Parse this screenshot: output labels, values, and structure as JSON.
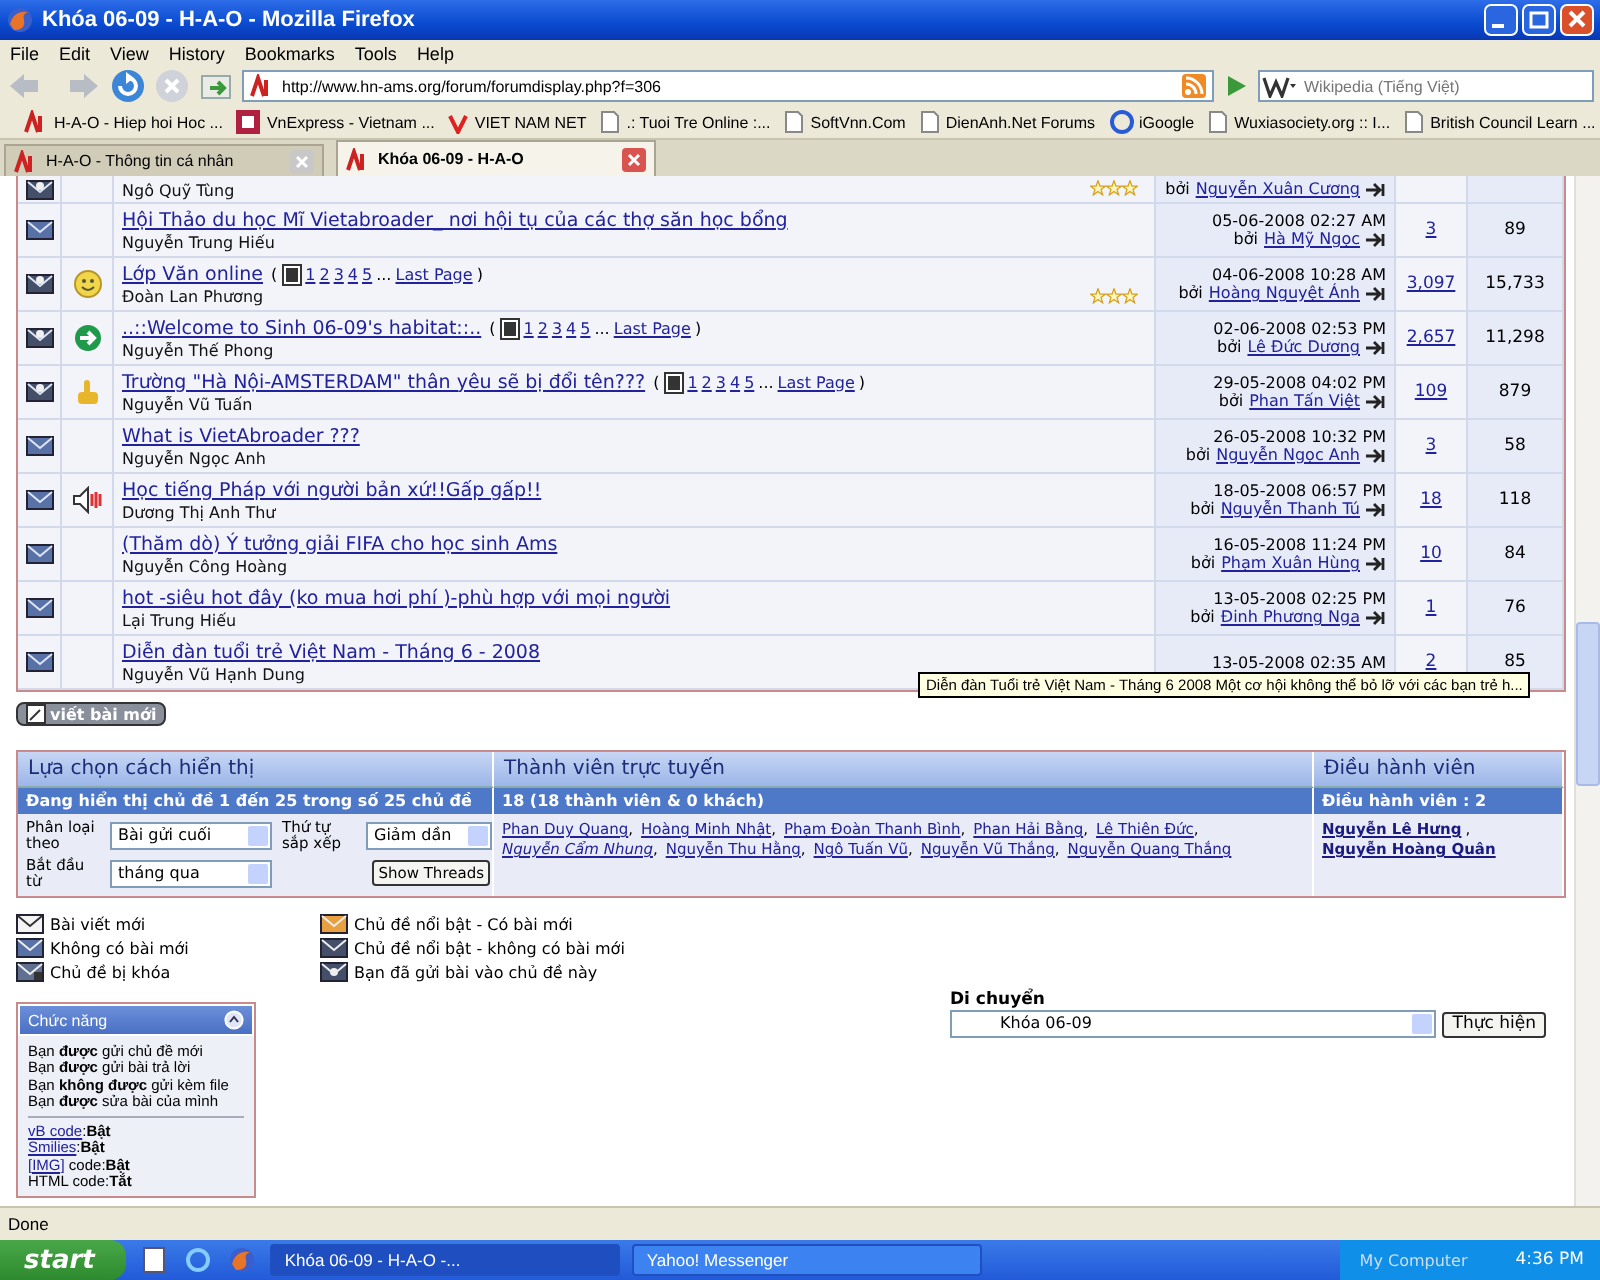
{
  "window": {
    "title": "Khóa 06-09 - H-A-O - Mozilla Firefox"
  },
  "menu": [
    "File",
    "Edit",
    "View",
    "History",
    "Bookmarks",
    "Tools",
    "Help"
  ],
  "nav": {
    "url": "http://www.hn-ams.org/forum/forumdisplay.php?f=306",
    "search_placeholder": "Wikipedia (Tiếng Việt)"
  },
  "bookmarks": [
    {
      "label": "H-A-O - Hiep hoi Hoc ...",
      "kind": "hao"
    },
    {
      "label": "VnExpress - Vietnam ...",
      "kind": "vne"
    },
    {
      "label": "VIET NAM NET",
      "kind": "vnn"
    },
    {
      "label": ".: Tuoi Tre Online :...",
      "kind": "page"
    },
    {
      "label": "SoftVnn.Com",
      "kind": "page"
    },
    {
      "label": "DienAnh.Net Forums",
      "kind": "page"
    },
    {
      "label": "iGoogle",
      "kind": "google"
    },
    {
      "label": "Wuxiasociety.org :: I...",
      "kind": "page"
    },
    {
      "label": "British Council Learn ...",
      "kind": "page"
    }
  ],
  "tabs": [
    {
      "label": "H-A-O - Thông tin cá nhân",
      "selected": false
    },
    {
      "label": "Khóa 06-09 - H-A-O",
      "selected": true
    }
  ],
  "threads": [
    {
      "hot": true,
      "kind": "none",
      "author": "Ngô Quỹ Tùng",
      "stars": 3,
      "by_label": "bởi",
      "by": "Nguyễn Xuân Cương"
    },
    {
      "hot": false,
      "kind": "none",
      "title": "Hội Thảo du học Mĩ Vietabroader_ nơi hội tụ của các thợ săn học bổng",
      "author": "Nguyễn Trung Hiếu",
      "date": "05-06-2008 02:27 AM",
      "by_label": "bởi",
      "by": "Hà Mỹ Ngọc",
      "replies": "3",
      "views": "89"
    },
    {
      "hot": true,
      "kind": "smile",
      "title": "Lớp Văn online",
      "pages": {
        "open": "(",
        "numbers": [
          "1",
          "2",
          "3",
          "4",
          "5"
        ],
        "ellipsis": "...",
        "last": "Last Page",
        "close": ")"
      },
      "author": "Đoàn Lan Phương",
      "stars": 3,
      "date": "04-06-2008 10:28 AM",
      "by_label": "bởi",
      "by": "Hoàng Nguyệt Ánh",
      "replies": "3,097",
      "views": "15,733"
    },
    {
      "hot": true,
      "kind": "arrow",
      "title": "..::Welcome to Sinh 06-09's habitat::..",
      "pages": {
        "open": "(",
        "numbers": [
          "1",
          "2",
          "3",
          "4",
          "5"
        ],
        "ellipsis": "...",
        "last": "Last Page",
        "close": ")"
      },
      "author": "Nguyễn Thế Phong",
      "date": "02-06-2008 02:53 PM",
      "by_label": "bởi",
      "by": "Lê Đức Dương",
      "replies": "2,657",
      "views": "11,298"
    },
    {
      "hot": true,
      "kind": "thumb",
      "title": "Trường \"Hà Nội-AMSTERDAM\" thân yêu sẽ bị đổi tên???",
      "pages": {
        "open": "(",
        "numbers": [
          "1",
          "2",
          "3",
          "4",
          "5"
        ],
        "ellipsis": "...",
        "last": "Last Page",
        "close": ")"
      },
      "author": "Nguyễn Vũ Tuấn",
      "date": "29-05-2008 04:02 PM",
      "by_label": "bởi",
      "by": "Phan Tấn Việt",
      "replies": "109",
      "views": "879"
    },
    {
      "hot": false,
      "kind": "none",
      "title": "What is VietAbroader ???",
      "author": "Nguyễn Ngọc Anh",
      "date": "26-05-2008 10:32 PM",
      "by_label": "bởi",
      "by": "Nguyễn Ngọc Anh",
      "replies": "3",
      "views": "58"
    },
    {
      "hot": false,
      "kind": "speaker",
      "title": "Học tiếng Pháp với người bản xứ!!Gấp gấp!!",
      "author": "Dương Thị Anh Thư",
      "date": "18-05-2008 06:57 PM",
      "by_label": "bởi",
      "by": "Nguyễn Thanh Tú",
      "replies": "18",
      "views": "118"
    },
    {
      "hot": false,
      "kind": "none",
      "title": "(Thăm dò) Ý tưởng giải FIFA cho học sinh Ams",
      "author": "Nguyễn Công Hoàng",
      "date": "16-05-2008 11:24 PM",
      "by_label": "bởi",
      "by": "Phạm Xuân Hùng",
      "replies": "10",
      "views": "84"
    },
    {
      "hot": false,
      "kind": "none",
      "title": "hot -siêu hot đây (ko mua hơi phí )-phù hợp với mọi người",
      "author": "Lại Trung Hiếu",
      "date": "13-05-2008 02:25 PM",
      "by_label": "bởi",
      "by": "Đinh Phương Nga",
      "replies": "1",
      "views": "76"
    },
    {
      "hot": false,
      "kind": "none",
      "title": "Diễn đàn tuổi trẻ Việt Nam - Tháng 6 - 2008",
      "author": "Nguyễn Vũ Hạnh Dung",
      "date": "13-05-2008 02:35 AM",
      "replies": "2",
      "views": "85"
    }
  ],
  "tooltip": "Diễn đàn Tuổi trẻ Việt Nam - Tháng 6 2008 Một cơ hội không thể bỏ lỡ với các bạn trẻ h...",
  "new_thread_button": "viết bài mới",
  "display_options": {
    "title": "Lựa chọn cách hiển thị",
    "subtitle": "Đang hiển thị chủ đề 1 đến 25 trong số 25 chủ đề",
    "sort_label": "Phân loại theo",
    "sort_value": "Bài gửi cuối",
    "order_label": "Thứ tự sắp xếp",
    "order_value": "Giảm dần",
    "from_label": "Bắt đầu từ",
    "from_value": "tháng qua",
    "button": "Show Threads"
  },
  "online": {
    "title": "Thành viên trực tuyến",
    "subtitle": "18 (18 thành viên & 0 khách)",
    "members": [
      {
        "name": "Phan Duy Quang",
        "italic": false,
        "sep": ","
      },
      {
        "name": "Hoàng Minh Nhật",
        "italic": false,
        "sep": ","
      },
      {
        "name": "Phạm Đoàn Thanh Bình",
        "italic": false,
        "sep": ","
      },
      {
        "name": "Phan Hải Bằng",
        "italic": false,
        "sep": ","
      },
      {
        "name": "Lê Thiên Đức",
        "italic": false,
        "sep": ","
      },
      {
        "name": "Nguyễn Cẩm Nhung",
        "italic": true,
        "sep": ","
      },
      {
        "name": "Nguyễn Thu Hằng",
        "italic": false,
        "sep": ","
      },
      {
        "name": "Ngô Tuấn Vũ",
        "italic": false,
        "sep": ","
      },
      {
        "name": "Nguyễn Vũ Thắng",
        "italic": false,
        "sep": ","
      },
      {
        "name": "Nguyễn Quang Thắng",
        "italic": false
      }
    ]
  },
  "moderators": {
    "title": "Điều hành viên",
    "subtitle": "Điều hành viên : 2",
    "names": [
      {
        "name": "Nguyễn Lê Hưng",
        "sep": ","
      },
      {
        "name": "Nguyễn Hoàng Quân"
      }
    ]
  },
  "legend": [
    {
      "label": "Bài viết mới",
      "kind": "new"
    },
    {
      "label": "Chủ đề nổi bật - Có bài mới",
      "kind": "hot-new"
    },
    {
      "label": "Không có bài mới",
      "kind": "old"
    },
    {
      "label": "Chủ đề nổi bật - không có bài mới",
      "kind": "hot-old"
    },
    {
      "label": "Chủ đề bị khóa",
      "kind": "locked"
    },
    {
      "label": "Bạn đã gửi bài vào chủ đề này",
      "kind": "posted"
    }
  ],
  "jump": {
    "label": "Di chuyển",
    "value": "Khóa 06-09",
    "button": "Thực hiện"
  },
  "permissions": {
    "title": "Chức năng",
    "lines": [
      "Bạn **được** gửi chủ đề mới",
      "Bạn **được** gửi bài trả lời",
      "Bạn **không được** gửi kèm file",
      "Bạn **được** sửa bài của mình"
    ],
    "settings": [
      {
        "link": "vB code",
        "label": ":",
        "value": "Bật"
      },
      {
        "link": "Smilies",
        "label": ":",
        "value": "Bật"
      },
      {
        "link": "[IMG]",
        "label": " code:",
        "value": "Bật"
      },
      {
        "label": "HTML code:",
        "value": "Tắt"
      }
    ]
  },
  "status_bar": "Done",
  "taskbar": {
    "start": "start",
    "items": [
      {
        "label": "Khóa 06-09 - H-A-O -...",
        "selected": true
      },
      {
        "label": "Yahoo! Messenger",
        "selected": false
      }
    ],
    "tray": "My Computer",
    "clock": "4:36 PM"
  }
}
